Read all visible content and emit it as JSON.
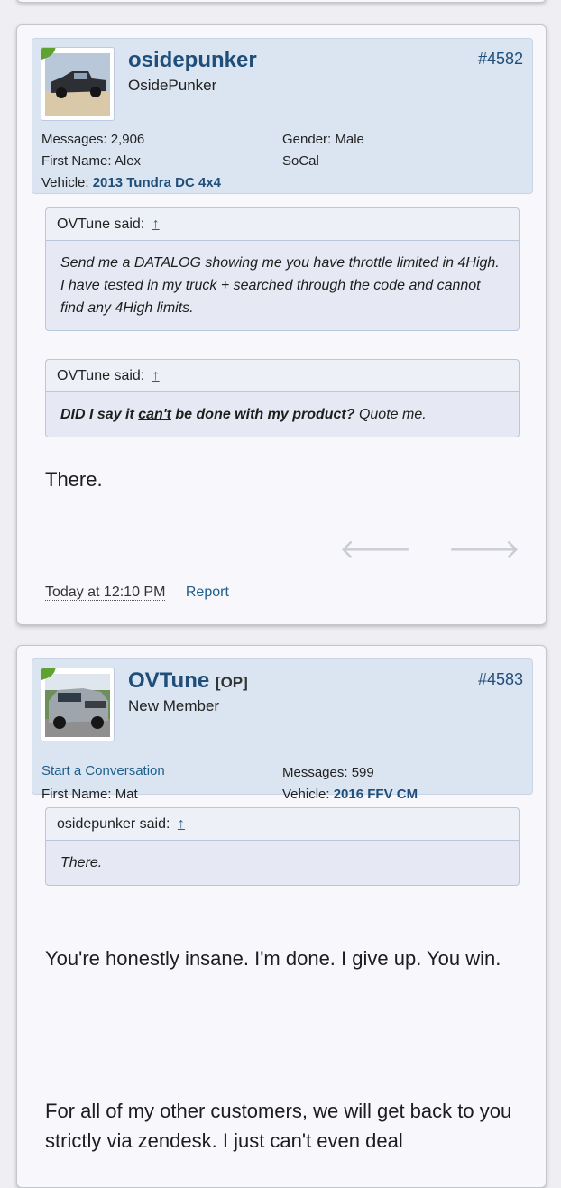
{
  "post1": {
    "username": "osidepunker",
    "user_title": "OsidePunker",
    "post_number": "#4582",
    "extras": {
      "messages_label": "Messages:",
      "messages_value": "2,906",
      "gender_label": "Gender:",
      "gender_value": "Male",
      "firstname_label": "First Name:",
      "firstname_value": "Alex",
      "location_value": "SoCal",
      "vehicle_label": "Vehicle:",
      "vehicle_value": "2013 Tundra DC 4x4"
    },
    "quotes": [
      {
        "author": "OVTune said:",
        "arrow": "↑",
        "text": "Send me a DATALOG showing me you have throttle limited in 4High. I have tested in my truck + searched through the code and cannot find any 4High limits."
      },
      {
        "author": "OVTune said:",
        "arrow": "↑",
        "text_bold_1": "DID I say it ",
        "text_bold_u": "can't",
        "text_bold_2": " be done with my product?",
        "text_rest": " Quote me."
      }
    ],
    "message": "There.",
    "prev_arrow": "🡐",
    "next_arrow": "🡒",
    "timestamp": "Today at 12:10 PM",
    "report": "Report"
  },
  "post2": {
    "username": "OVTune",
    "op_badge": "[OP]",
    "user_title": "New Member",
    "post_number": "#4583",
    "extras": {
      "conversation_link": "Start a Conversation",
      "messages_label": "Messages:",
      "messages_value": "599",
      "firstname_label": "First Name:",
      "firstname_value": "Mat",
      "vehicle_label": "Vehicle:",
      "vehicle_value": "2016 FFV CM"
    },
    "quote": {
      "author": "osidepunker said:",
      "arrow": "↑",
      "text": "There."
    },
    "message_1": "You're honestly insane. I'm done. I give up. You win.",
    "message_2": "For all of my other customers, we will get back to you strictly via zendesk. I just can't even deal"
  }
}
